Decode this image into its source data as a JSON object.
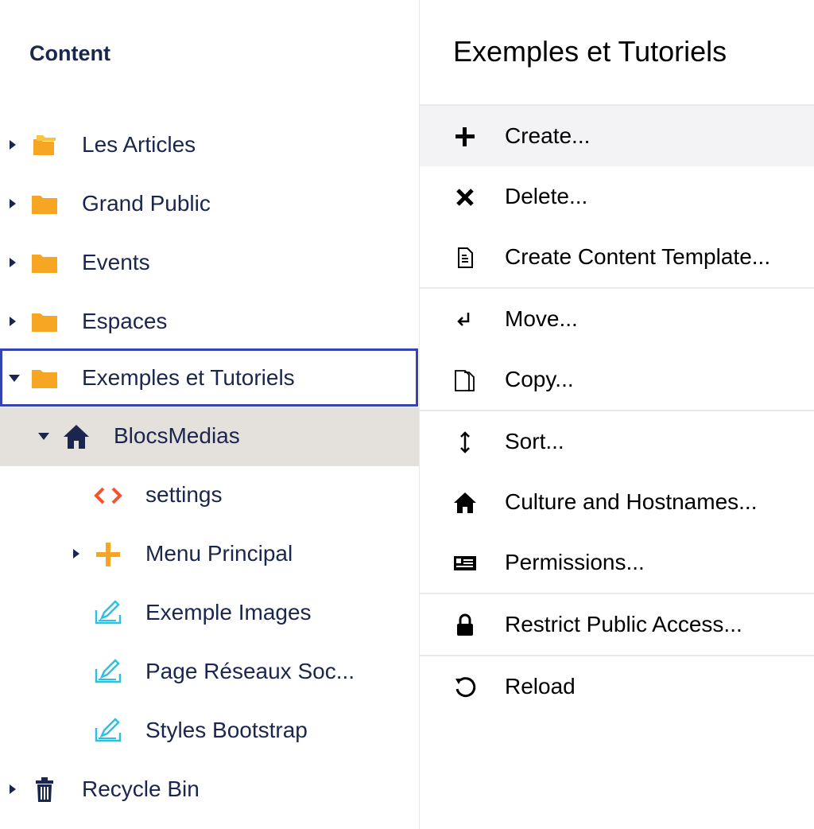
{
  "tree": {
    "header": "Content",
    "nodes": [
      {
        "label": "Les Articles"
      },
      {
        "label": "Grand Public"
      },
      {
        "label": "Events"
      },
      {
        "label": "Espaces"
      },
      {
        "label": "Exemples et Tutoriels"
      },
      {
        "label": "BlocsMedias"
      },
      {
        "label": "settings"
      },
      {
        "label": "Menu Principal"
      },
      {
        "label": "Exemple Images"
      },
      {
        "label": "Page Réseaux Soc..."
      },
      {
        "label": "Styles Bootstrap"
      },
      {
        "label": "Recycle Bin"
      }
    ]
  },
  "menu": {
    "title": "Exemples et Tutoriels",
    "items": [
      {
        "label": "Create..."
      },
      {
        "label": "Delete..."
      },
      {
        "label": "Create Content Template..."
      },
      {
        "label": "Move..."
      },
      {
        "label": "Copy..."
      },
      {
        "label": "Sort..."
      },
      {
        "label": "Culture and Hostnames..."
      },
      {
        "label": "Permissions..."
      },
      {
        "label": "Restrict Public Access..."
      },
      {
        "label": "Reload"
      }
    ]
  },
  "colors": {
    "folder": "#f6a623",
    "navy": "#1b264f",
    "focus_border": "#3544b1",
    "active_bg": "#e4e1dd",
    "settings_icon": "#f5522d",
    "doc_icon": "#2bc0e4"
  }
}
